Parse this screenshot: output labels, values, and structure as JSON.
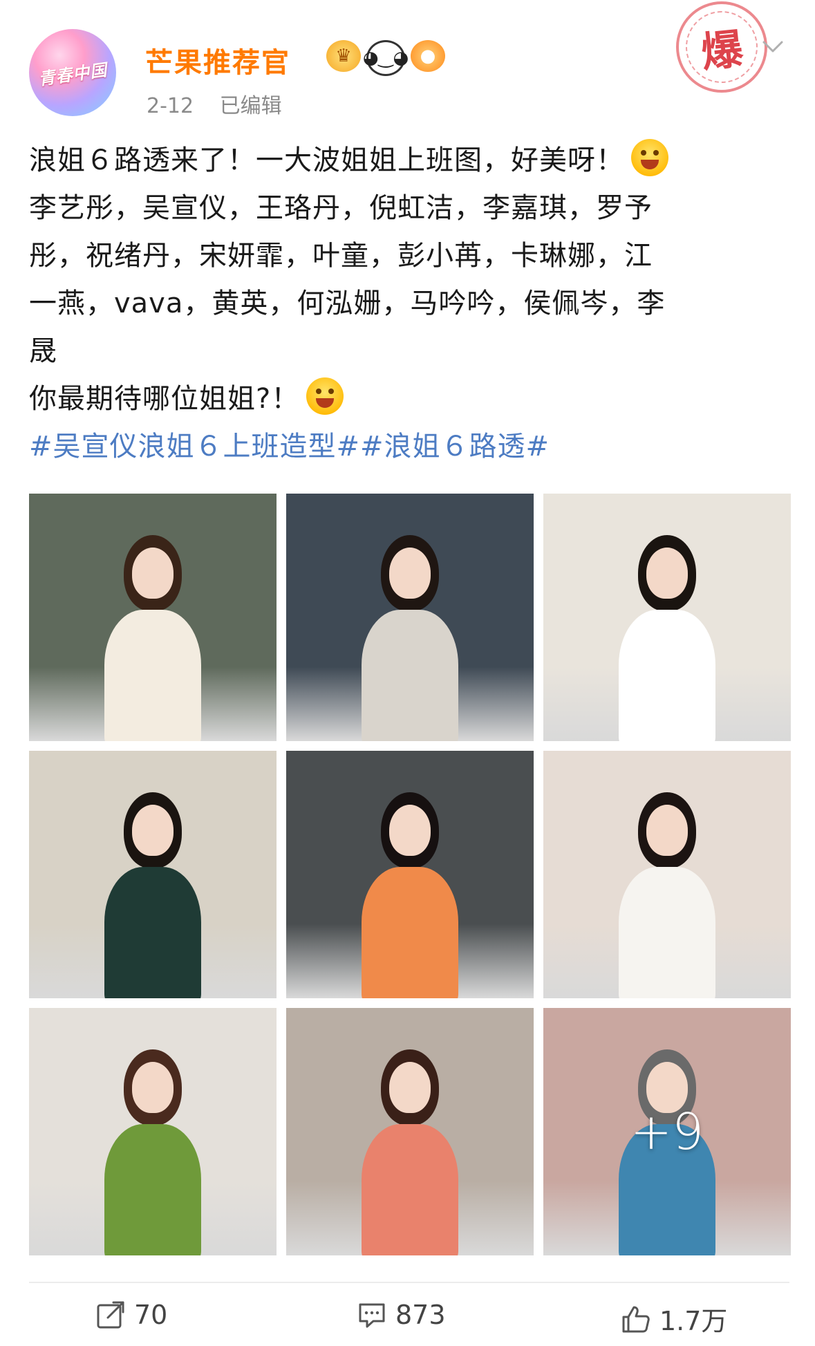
{
  "header": {
    "username": "芒果推荐官",
    "avatar_text": "青春中国",
    "date": "2-12",
    "edited": "已编辑",
    "stamp_text": "爆",
    "badges": [
      "crown-badge-icon",
      "panda-badge-icon",
      "fish-badge-icon"
    ]
  },
  "post": {
    "line1": "浪姐６路透来了！一大波姐姐上班图，好美呀！",
    "line2": "李艺彤，吴宣仪，王珞丹，倪虹洁，李嘉琪，罗予",
    "line3": "彤，祝绪丹，宋妍霏，叶童，彭小苒，卡琳娜，江",
    "line4": "一燕，vava，黄英，何泓姗，马吟吟，侯佩岑，李",
    "line5": "晟",
    "line6": "你最期待哪位姐姐?！",
    "hashtags": "#吴宣仪浪姐６上班造型##浪姐６路透#"
  },
  "gallery": {
    "extra_count": "+9",
    "photos": [
      {
        "bg": "#5f6a5c",
        "outfit": "#f3ece0",
        "hair": "#3a2418"
      },
      {
        "bg": "#3f4a55",
        "outfit": "#d9d4cc",
        "hair": "#1f1612"
      },
      {
        "bg": "#e9e4dc",
        "outfit": "#ffffff",
        "hair": "#1a1410"
      },
      {
        "bg": "#d8d2c6",
        "outfit": "#1f3b35",
        "hair": "#1a1410"
      },
      {
        "bg": "#4a4e50",
        "outfit": "#f08a4a",
        "hair": "#161010"
      },
      {
        "bg": "#e6dcd4",
        "outfit": "#f6f4f0",
        "hair": "#1c1412"
      },
      {
        "bg": "#e4e0da",
        "outfit": "#6f9a3a",
        "hair": "#4a2a1e"
      },
      {
        "bg": "#b9aea4",
        "outfit": "#e9826c",
        "hair": "#3a2018"
      },
      {
        "bg": "#c9a7a0",
        "outfit": "#3f86b0",
        "hair": "#6a6a6a"
      }
    ]
  },
  "actions": {
    "repost_count": "70",
    "comment_count": "873",
    "like_count": "1.7万"
  },
  "colors": {
    "username": "#ff7a00",
    "hashtag": "#4d7cc3",
    "meta": "#8a8a8a"
  }
}
